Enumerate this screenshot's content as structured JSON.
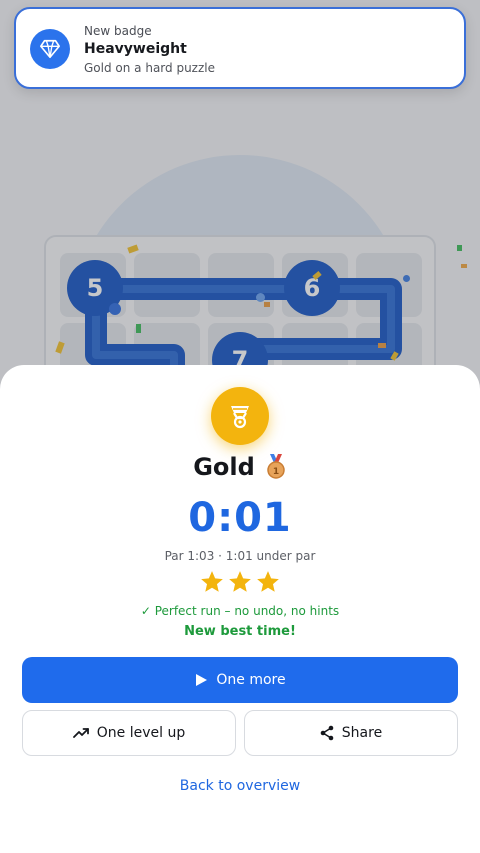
{
  "toast": {
    "kicker": "New badge",
    "title": "Heavyweight",
    "subtitle": "Gold on a hard puzzle",
    "icon": "diamond-icon",
    "accent": "#2b73ec"
  },
  "board": {
    "nodes": [
      "5",
      "6",
      "7"
    ],
    "path_color": "#1655c4"
  },
  "result": {
    "medal_icon": "medal-icon",
    "tier": "Gold",
    "tier_emoji": "🥉",
    "time": "0:01",
    "par_line": "Par 1:03 · 1:01 under par",
    "stars": 3,
    "stars_max": 3,
    "perfect_line": "✓ Perfect run – no undo, no hints",
    "best_line": "New best time!"
  },
  "actions": {
    "primary_label": "One more",
    "level_up_label": "One level up",
    "share_label": "Share",
    "back_label": "Back to overview"
  },
  "colors": {
    "primary": "#1f6bec",
    "success": "#1e9a3c",
    "gold": "#f3b40e"
  }
}
